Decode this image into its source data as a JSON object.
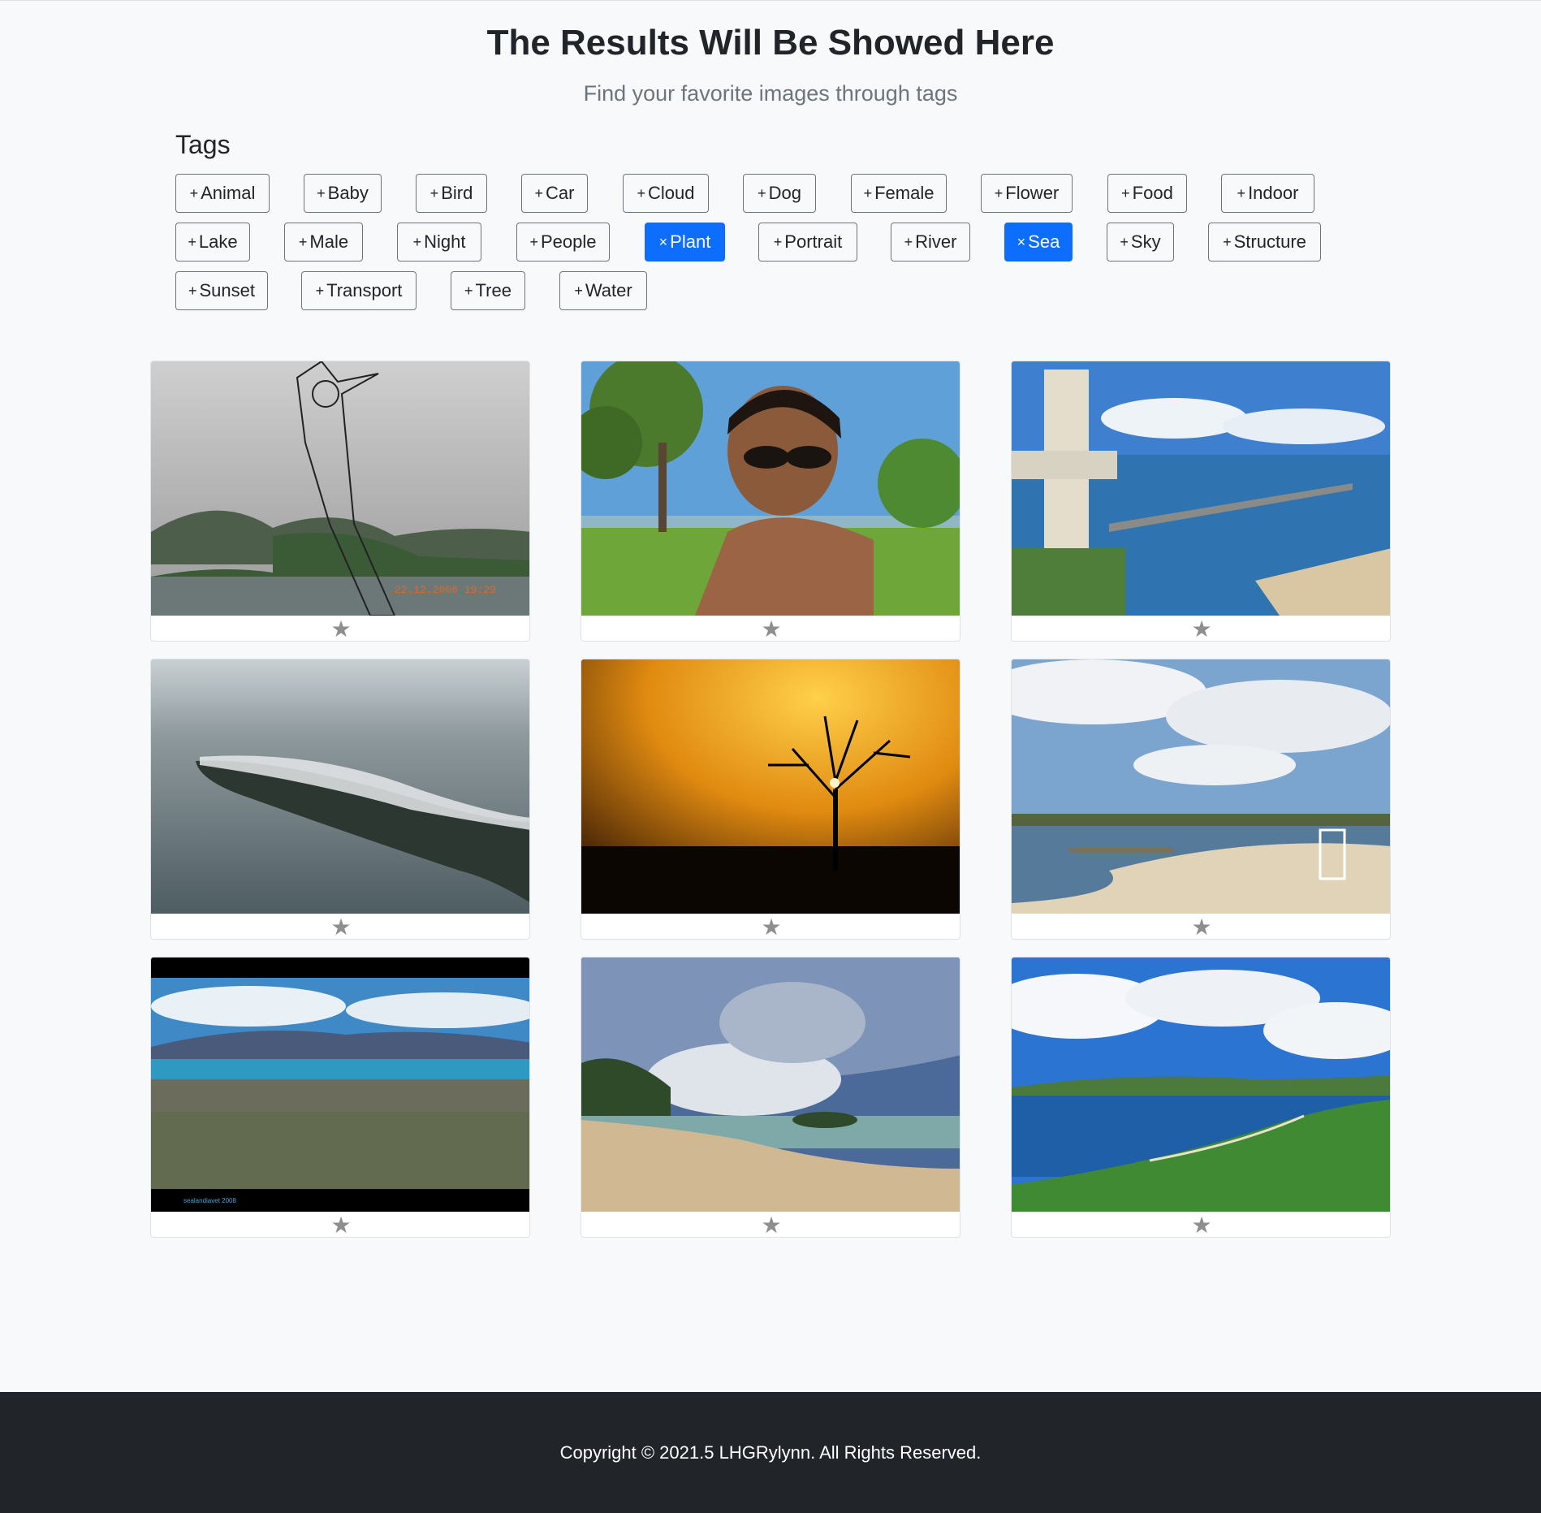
{
  "header": {
    "title": "The Results Will Be Showed Here",
    "subtitle": "Find your favorite images through tags"
  },
  "tags": {
    "heading": "Tags",
    "add_symbol": "+",
    "remove_symbol": "×",
    "rows": [
      [
        {
          "label": "Animal",
          "selected": false
        },
        {
          "label": "Baby",
          "selected": false
        },
        {
          "label": "Bird",
          "selected": false
        },
        {
          "label": "Car",
          "selected": false
        },
        {
          "label": "Cloud",
          "selected": false
        },
        {
          "label": "Dog",
          "selected": false
        },
        {
          "label": "Female",
          "selected": false
        },
        {
          "label": "Flower",
          "selected": false
        },
        {
          "label": "Food",
          "selected": false
        },
        {
          "label": "Indoor",
          "selected": false
        }
      ],
      [
        {
          "label": "Lake",
          "selected": false
        },
        {
          "label": "Male",
          "selected": false
        },
        {
          "label": "Night",
          "selected": false
        },
        {
          "label": "People",
          "selected": false
        },
        {
          "label": "Plant",
          "selected": true
        },
        {
          "label": "Portrait",
          "selected": false
        },
        {
          "label": "River",
          "selected": false
        },
        {
          "label": "Sea",
          "selected": true
        },
        {
          "label": "Sky",
          "selected": false
        },
        {
          "label": "Structure",
          "selected": false
        }
      ],
      [
        {
          "label": "Sunset",
          "selected": false
        },
        {
          "label": "Transport",
          "selected": false
        },
        {
          "label": "Tree",
          "selected": false
        },
        {
          "label": "Water",
          "selected": false
        }
      ]
    ]
  },
  "gallery": {
    "favorite_icon": "star-icon",
    "images": [
      {
        "subject": "lake-landscape-with-sketch-overlay",
        "date_stamp": "22.12.2006 19:29"
      },
      {
        "subject": "smiling-woman-in-sunglasses"
      },
      {
        "subject": "harbor-elevator-tower"
      },
      {
        "subject": "aerial-island-with-fog"
      },
      {
        "subject": "tree-silhouette-sunset"
      },
      {
        "subject": "beach-with-lifeguard-chair"
      },
      {
        "subject": "aerial-city-panorama",
        "caption": "sealandiavet 2008"
      },
      {
        "subject": "cloudy-beach-shore"
      },
      {
        "subject": "coastal-bay-green-hills"
      }
    ]
  },
  "footer": {
    "copyright": "Copyright © 2021.5 LHGRylynn. All Rights Reserved."
  },
  "colors": {
    "accent": "#0d6efd",
    "page_background": "#f8f9fa",
    "footer_background": "#212529",
    "star": "#8e8e8e"
  }
}
